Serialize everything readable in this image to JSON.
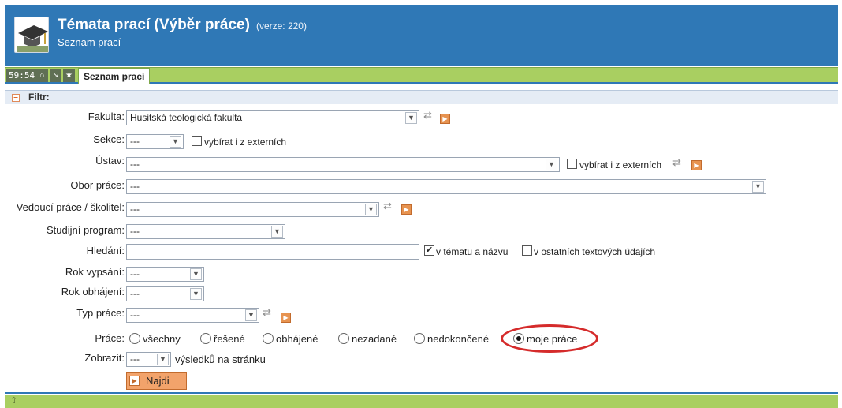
{
  "header": {
    "title": "Témata prací (Výběr práce)",
    "version": "(verze: 220)",
    "subtitle": "Seznam prací",
    "logo_icon": "graduation-cap-icon"
  },
  "tabbar": {
    "clock": "59:54",
    "icons": [
      "home-icon",
      "minimize-icon",
      "star-icon"
    ],
    "home_glyph": "⌂",
    "min_glyph": "↘",
    "star_glyph": "★",
    "active_tab": "Seznam prací"
  },
  "filter": {
    "header_label": "Filtr:",
    "collapse_glyph": "–",
    "fakulta": {
      "label": "Fakulta:",
      "value": "Husitská teologická fakulta"
    },
    "sekce": {
      "label": "Sekce:",
      "value": "---",
      "checkbox_label": "vybírat i z externích"
    },
    "ustav": {
      "label": "Ústav:",
      "value": "---",
      "checkbox_label": "vybírat i z externích"
    },
    "obor": {
      "label": "Obor práce:",
      "value": "---"
    },
    "vedouci": {
      "label": "Vedoucí práce / školitel:",
      "value": "---"
    },
    "program": {
      "label": "Studijní program:",
      "value": "---"
    },
    "hledani": {
      "label": "Hledání:",
      "value": "",
      "cb1_label": "v tématu a názvu",
      "cb1_checked": true,
      "cb2_label": "v ostatních textových údajích",
      "cb2_checked": false
    },
    "rok_vypsani": {
      "label": "Rok vypsání:",
      "value": "---"
    },
    "rok_obhajeni": {
      "label": "Rok obhájení:",
      "value": "---"
    },
    "typ": {
      "label": "Typ práce:",
      "value": "---"
    },
    "prace": {
      "label": "Práce:",
      "options": [
        "všechny",
        "řešené",
        "obhájené",
        "nezadané",
        "nedokončené",
        "moje práce"
      ],
      "selected": "moje práce"
    },
    "zobrazit": {
      "label": "Zobrazit:",
      "value": "---",
      "suffix": "výsledků na stránku"
    },
    "najdi_label": "Najdi"
  },
  "glyphs": {
    "arrow": "▼",
    "swap": "⇄",
    "go": "▶",
    "check": "✔",
    "up": "⇧"
  },
  "colors": {
    "header_bg": "#2f78b6",
    "tabbar_bg": "#a9cf61",
    "highlight_ellipse": "#d52b2b",
    "button_bg": "#f2a36b"
  }
}
